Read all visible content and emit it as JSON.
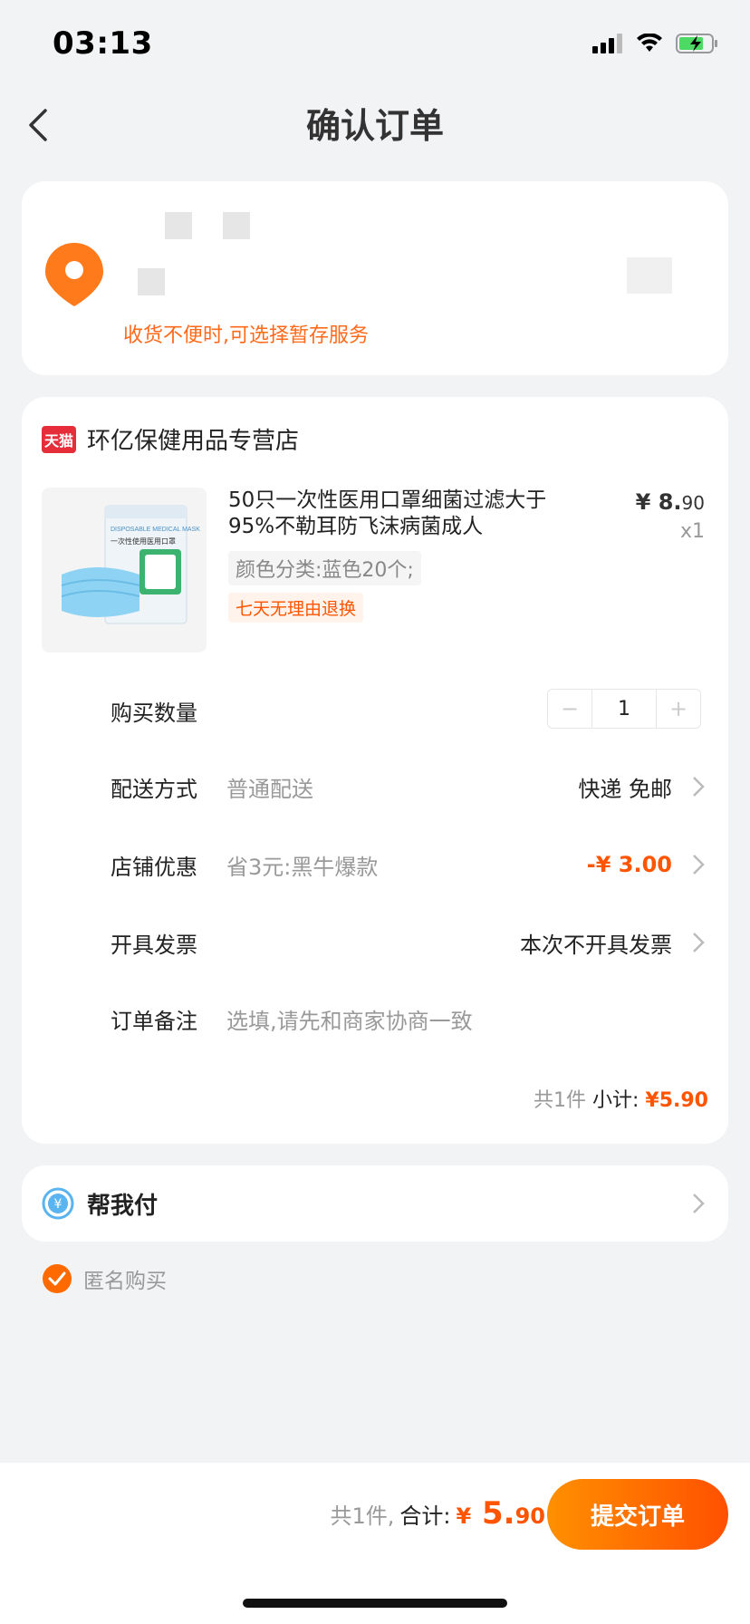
{
  "status": {
    "time": "03:13"
  },
  "nav": {
    "title": "确认订单"
  },
  "address": {
    "note": "收货不便时,可选择暂存服务"
  },
  "shop": {
    "logo_text": "天猫",
    "name": "环亿保健用品专营店"
  },
  "product": {
    "title": "50只一次性医用口罩细菌过滤大于95%不勒耳防飞沫病菌成人",
    "price_symbol": "¥",
    "price_int": "8.",
    "price_dec": "90",
    "qty": "x1",
    "sku": "颜色分类:蓝色20个;",
    "tag": "七天无理由退换",
    "image_label_top": "DISPOSABLE MEDICAL MASK",
    "image_label_cn": "一次性使用医用口罩"
  },
  "rows": {
    "quantity": {
      "label": "购买数量",
      "minus": "−",
      "value": "1",
      "plus": "+"
    },
    "delivery": {
      "label": "配送方式",
      "sub": "普通配送",
      "value": "快递 免邮"
    },
    "discount": {
      "label": "店铺优惠",
      "sub": "省3元:黑牛爆款",
      "value": "-¥ 3.00"
    },
    "invoice": {
      "label": "开具发票",
      "value": "本次不开具发票"
    },
    "remark": {
      "label": "订单备注",
      "placeholder": "选填,请先和商家协商一致"
    }
  },
  "subtotal": {
    "count": "共1件",
    "label": "小计:",
    "symbol": "¥",
    "amount_int": "5.",
    "amount_dec": "90"
  },
  "pay": {
    "icon_char": "¥",
    "label": "帮我付"
  },
  "anonymous": {
    "label": "匿名购买",
    "checked": true
  },
  "bottom": {
    "count": "共1件,",
    "label": "合计:",
    "symbol": "¥",
    "amount_int": "5.",
    "amount_dec": "90",
    "submit": "提交订单"
  },
  "colors": {
    "accent": "#ff5500",
    "tmall_red": "#e62e3a"
  }
}
